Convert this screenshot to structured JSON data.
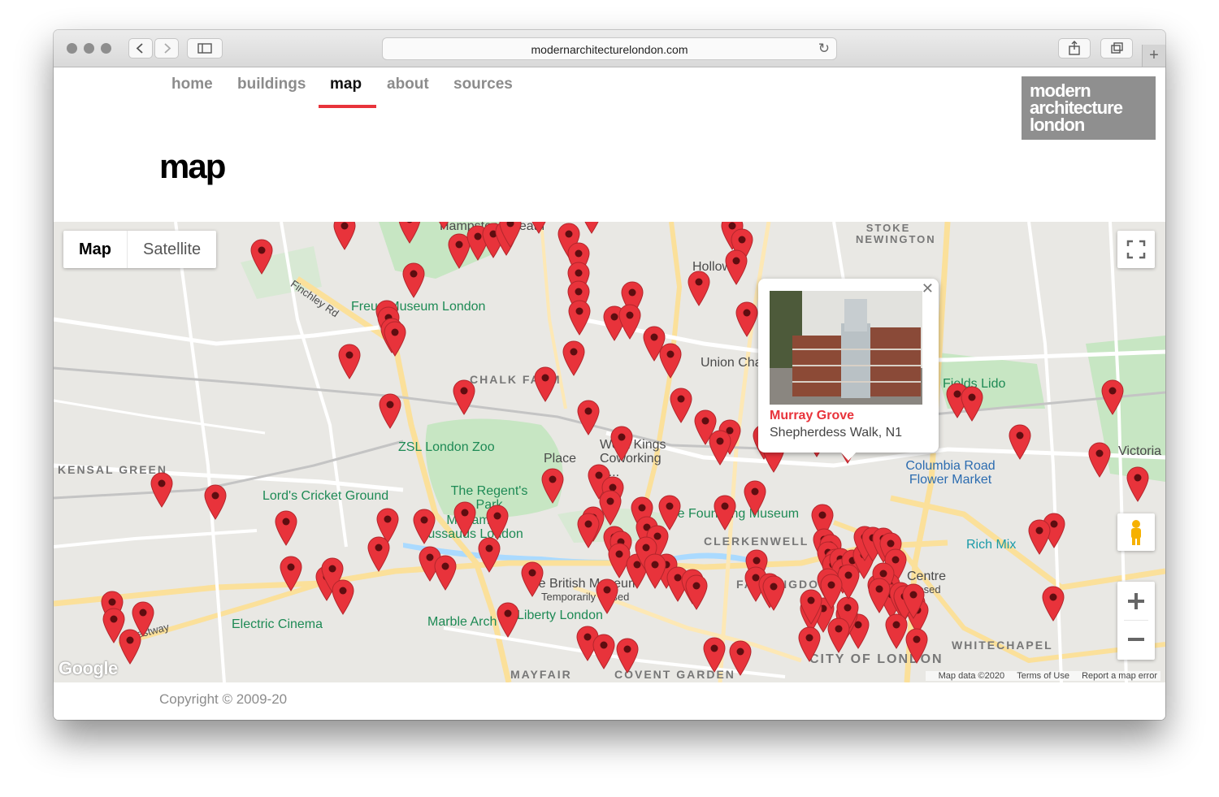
{
  "browser": {
    "url": "modernarchitecturelondon.com"
  },
  "nav": {
    "items": [
      "home",
      "buildings",
      "map",
      "about",
      "sources"
    ],
    "active": "map"
  },
  "logo": {
    "lines": [
      "modern",
      "architecture",
      "london"
    ]
  },
  "page": {
    "title": "map"
  },
  "map": {
    "map_type_options": [
      "Map",
      "Satellite"
    ],
    "selected_map_type": "Map",
    "labels": {
      "hampstead_heath": "Hampstead Heath",
      "freud_museum": "Freud Museum London",
      "chalk_farm": "CHALK FARM",
      "zsl_zoo": "ZSL London Zoo",
      "kensal_green": "KENSAL GREEN",
      "lords": "Lord's Cricket Ground",
      "regents_park": "The Regent's Park",
      "madame_tussauds": "Madame Tussauds London",
      "electric_cinema": "Electric Cinema",
      "marble_arch": "Marble Arch",
      "liberty": "Liberty London",
      "mayfair": "MAYFAIR",
      "covent_garden": "COVENT GARDEN",
      "british_museum": "The British Museum",
      "british_museum_note": "Temporarily closed",
      "foundling": "The Foundling Museum",
      "clerkenwell": "CLERKENWELL",
      "farringdon": "FARRINGDON",
      "city_of_london": "CITY OF LONDON",
      "whitechapel": "WHITECHAPEL",
      "stoke_newington": "STOKE NEWINGTON",
      "holloway": "Holloway",
      "union": "Union Chapel",
      "fields_lido": "Fields Lido",
      "victoria_park": "Victoria Park",
      "columbia_road": "Columbia Road Flower Market",
      "rich_mix": "Rich Mix",
      "centre": "Centre",
      "closed": "closed",
      "place": "Place",
      "work_kings": "Work Kings Coworking &...",
      "westway": "Westway",
      "finchley_rd": "Finchley Rd"
    },
    "infowindow": {
      "name": "Murray Grove",
      "address": "Shepherdess Walk, N1"
    },
    "attribution": {
      "data": "Map data ©2020",
      "terms": "Terms of Use",
      "report": "Report a map error"
    },
    "google_logo": "Google",
    "pin_color": "#e8333b",
    "pin_count_visible": 180
  },
  "footer": {
    "copyright": "Copyright © 2009-20"
  }
}
